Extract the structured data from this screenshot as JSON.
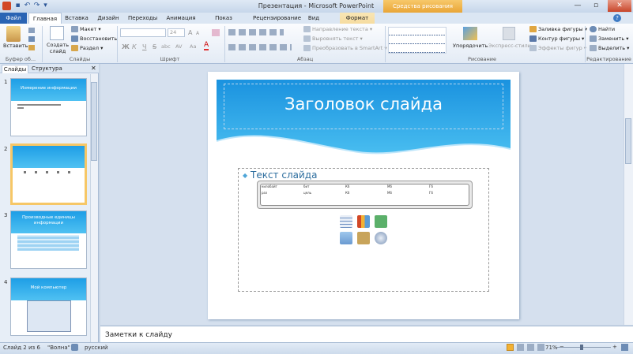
{
  "window": {
    "title": "Презентация  -  Microsoft PowerPoint",
    "context_group": "Средства рисования",
    "minimize": "—",
    "maximize": "▫",
    "close": "✕"
  },
  "qat": {
    "save": "▪",
    "undo": "↶",
    "redo": "↷",
    "customize": "▾"
  },
  "tabs": [
    "Файл",
    "Главная",
    "Вставка",
    "Дизайн",
    "Переходы",
    "Анимация",
    "Показ слайдов",
    "Рецензирование",
    "Вид",
    "Формат"
  ],
  "ribbon": {
    "clipboard": {
      "paste": "Вставить",
      "label": "Буфер об..."
    },
    "slides": {
      "new_slide": "Создать слайд",
      "layout": "Макет ▾",
      "reset": "Восстановить",
      "section": "Раздел ▾",
      "label": "Слайды"
    },
    "font": {
      "size": "24",
      "bold": "Ж",
      "italic": "К",
      "underline": "Ч",
      "strike": "S",
      "shadow": "abc",
      "spacing": "AV",
      "case": "Aa",
      "color": "A",
      "grow": "A",
      "shrink": "A",
      "label": "Шрифт"
    },
    "paragraph": {
      "text_direction": "Направление текста ▾",
      "align_text": "Выровнять текст ▾",
      "smartart": "Преобразовать в SmartArt ▾",
      "label": "Абзац"
    },
    "drawing": {
      "arrange": "Упорядочить",
      "quick_styles": "Экспресс-стили",
      "fill": "Заливка фигуры ▾",
      "outline": "Контур фигуры ▾",
      "effects": "Эффекты фигур ▾",
      "label": "Рисование"
    },
    "editing": {
      "find": "Найти",
      "replace": "Заменить ▾",
      "select": "Выделить ▾",
      "label": "Редактирование"
    },
    "help_icon": "?"
  },
  "left_pane": {
    "tab_slides": "Слайды",
    "tab_outline": "Структура",
    "close": "✕",
    "thumbs": [
      {
        "num": "1",
        "title": "Измерение информации"
      },
      {
        "num": "2",
        "title": ""
      },
      {
        "num": "3",
        "title": "Производные единицы информации"
      },
      {
        "num": "4",
        "title": "Мой компьютер"
      }
    ]
  },
  "slide": {
    "title": "Заголовок слайда",
    "body": "Текст слайда",
    "table_row1": [
      "килобайт",
      "бит",
      "Кб",
      "Мб",
      "Гб"
    ],
    "table_row2": [
      "раз",
      "цель",
      "Кб",
      "Мб",
      "Гб"
    ]
  },
  "notes": "Заметки к слайду",
  "status": {
    "slide": "Слайд 2 из 6",
    "theme": "\"Волна\"",
    "language": "русский",
    "zoom": "71%",
    "zoom_minus": "−",
    "zoom_plus": "+"
  },
  "colors": {
    "accent": "#2a64b4",
    "slide_band": "#1e9ee6",
    "context": "#e9a536"
  }
}
